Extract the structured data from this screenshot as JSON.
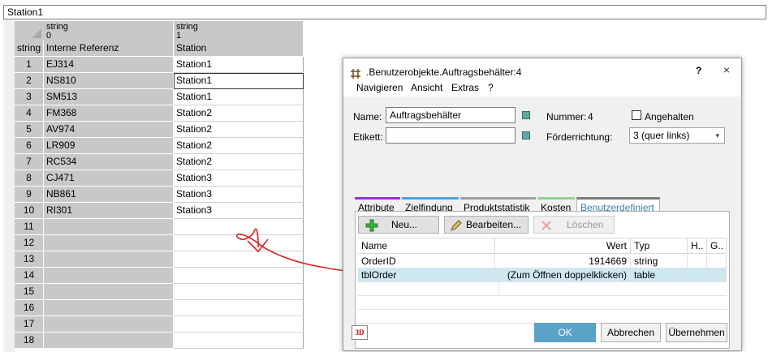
{
  "title_field": "Station1",
  "sheet": {
    "corner_label": "",
    "col_types": [
      {
        "type": "string",
        "index": "0"
      },
      {
        "type": "string",
        "index": "1"
      }
    ],
    "row_type_label": "string",
    "col_names": [
      "Interne Referenz",
      "Station"
    ],
    "rows": [
      {
        "n": "1",
        "ref": "EJ314",
        "station": "Station1"
      },
      {
        "n": "2",
        "ref": "NS810",
        "station": "Station1"
      },
      {
        "n": "3",
        "ref": "SM513",
        "station": "Station1"
      },
      {
        "n": "4",
        "ref": "FM368",
        "station": "Station2"
      },
      {
        "n": "5",
        "ref": "AV974",
        "station": "Station2"
      },
      {
        "n": "6",
        "ref": "LR909",
        "station": "Station2"
      },
      {
        "n": "7",
        "ref": "RC534",
        "station": "Station2"
      },
      {
        "n": "8",
        "ref": "CJ471",
        "station": "Station3"
      },
      {
        "n": "9",
        "ref": "NB861",
        "station": "Station3"
      },
      {
        "n": "10",
        "ref": "RI301",
        "station": "Station3"
      },
      {
        "n": "11",
        "ref": "",
        "station": ""
      },
      {
        "n": "12",
        "ref": "",
        "station": ""
      },
      {
        "n": "13",
        "ref": "",
        "station": ""
      },
      {
        "n": "14",
        "ref": "",
        "station": ""
      },
      {
        "n": "15",
        "ref": "",
        "station": ""
      },
      {
        "n": "16",
        "ref": "",
        "station": ""
      },
      {
        "n": "17",
        "ref": "",
        "station": ""
      },
      {
        "n": "18",
        "ref": "",
        "station": ""
      }
    ]
  },
  "dialog": {
    "title": ".Benutzerobjekte.Auftragsbehälter:4",
    "help": "?",
    "close": "×",
    "menu": [
      "Navigieren",
      "Ansicht",
      "Extras",
      "?"
    ],
    "name_label": "Name:",
    "name_value": "Auftragsbehälter",
    "etikett_label": "Etikett:",
    "etikett_value": "",
    "nummer_label": "Nummer:",
    "nummer_value": "4",
    "angehalten_label": "Angehalten",
    "foerder_label": "Förderrichtung:",
    "foerder_value": "3 (quer links)",
    "tabs": [
      {
        "label": "Attribute",
        "color": "#9b30d0"
      },
      {
        "label": "Zielfindung",
        "color": "#4aa3df"
      },
      {
        "label": "Produktstatistik",
        "color": "#a0a0a0"
      },
      {
        "label": "Kosten",
        "color": "#8fd48f"
      },
      {
        "label": "Benutzerdefiniert",
        "color": "#7a7a7a"
      }
    ],
    "btn_new": "Neu...",
    "btn_edit": "Bearbeiten...",
    "btn_delete": "Löschen",
    "table_headers": [
      "Name",
      "Wert",
      "Typ",
      "H..",
      "G.."
    ],
    "table_rows": [
      {
        "name": "OrderID",
        "wert": "1914669",
        "typ": "string"
      },
      {
        "name": "tblOrder",
        "wert": "(Zum Öffnen doppelklicken)",
        "typ": "table"
      }
    ],
    "ok": "OK",
    "cancel": "Abbrechen",
    "apply": "Übernehmen",
    "threed": "3D"
  }
}
